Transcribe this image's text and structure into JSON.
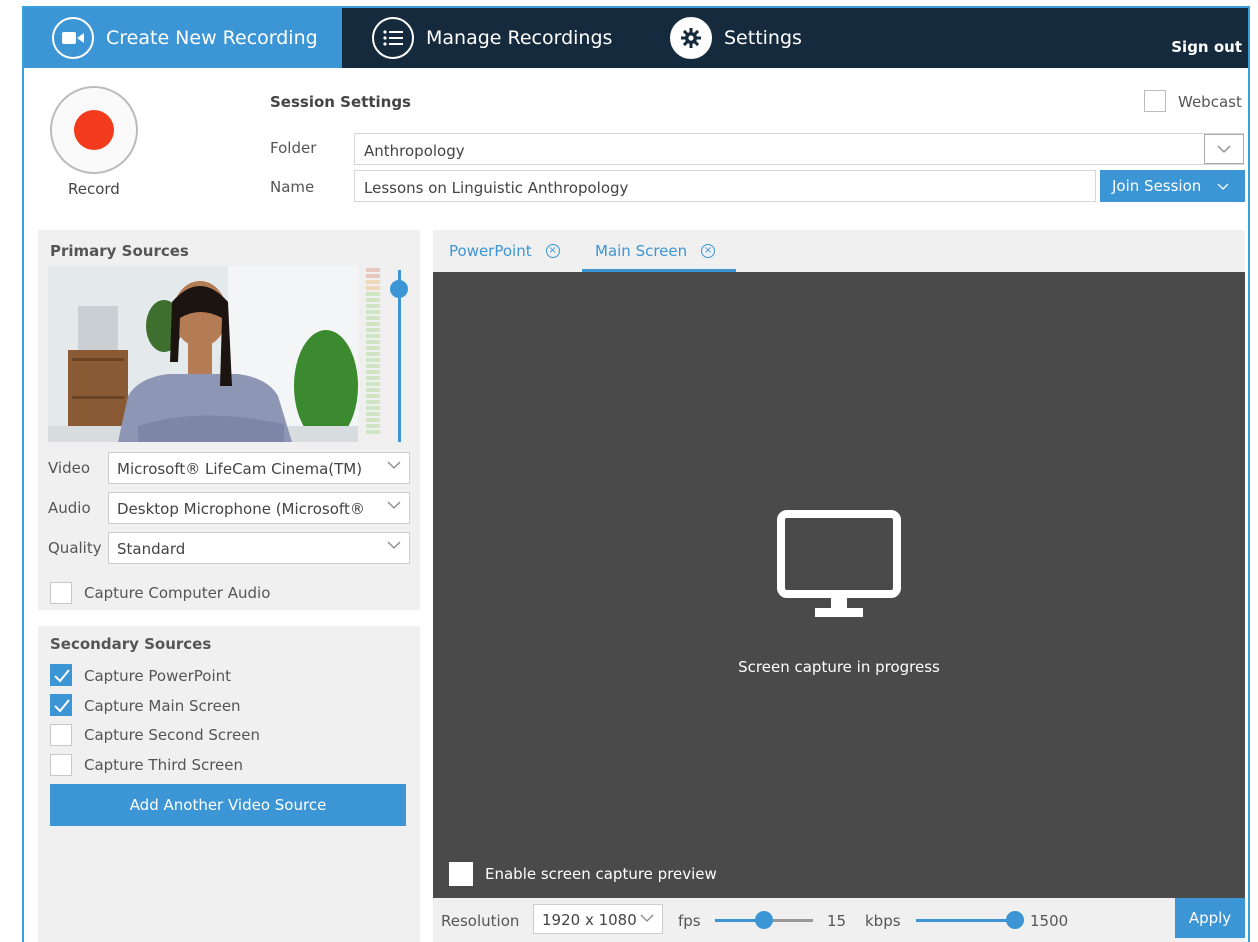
{
  "nav": {
    "tabs": [
      {
        "label": "Create New Recording",
        "icon": "camera-icon"
      },
      {
        "label": "Manage Recordings",
        "icon": "list-icon"
      },
      {
        "label": "Settings",
        "icon": "gear-icon"
      }
    ],
    "signout": "Sign out"
  },
  "session": {
    "record_label": "Record",
    "title": "Session Settings",
    "folder_label": "Folder",
    "folder_value": "Anthropology",
    "name_label": "Name",
    "name_value": "Lessons on Linguistic Anthropology",
    "join_label": "Join Session",
    "webcast_label": "Webcast",
    "webcast_checked": false
  },
  "primary": {
    "title": "Primary Sources",
    "video_label": "Video",
    "video_value": "Microsoft® LifeCam Cinema(TM)",
    "audio_label": "Audio",
    "audio_value": "Desktop Microphone (Microsoft®",
    "quality_label": "Quality",
    "quality_value": "Standard",
    "capture_audio_label": "Capture Computer Audio",
    "capture_audio_checked": false
  },
  "secondary": {
    "title": "Secondary Sources",
    "items": [
      {
        "label": "Capture PowerPoint",
        "checked": true
      },
      {
        "label": "Capture Main Screen",
        "checked": true
      },
      {
        "label": "Capture Second Screen",
        "checked": false
      },
      {
        "label": "Capture Third Screen",
        "checked": false
      }
    ],
    "add_button": "Add Another Video Source"
  },
  "preview": {
    "tabs": [
      {
        "label": "PowerPoint"
      },
      {
        "label": "Main Screen"
      }
    ],
    "active_tab": "Main Screen",
    "status_text": "Screen capture in progress",
    "enable_preview_label": "Enable screen capture preview"
  },
  "bottom": {
    "resolution_label": "Resolution",
    "resolution_value": "1920 x 1080",
    "fps_label": "fps",
    "fps_value": "15",
    "kbps_label": "kbps",
    "kbps_value": "1500",
    "apply_label": "Apply"
  },
  "colors": {
    "accent": "#3c95d4",
    "nav_bg": "#162a3d",
    "record_red": "#f23a1c",
    "preview_bg": "#4a4a4a"
  }
}
